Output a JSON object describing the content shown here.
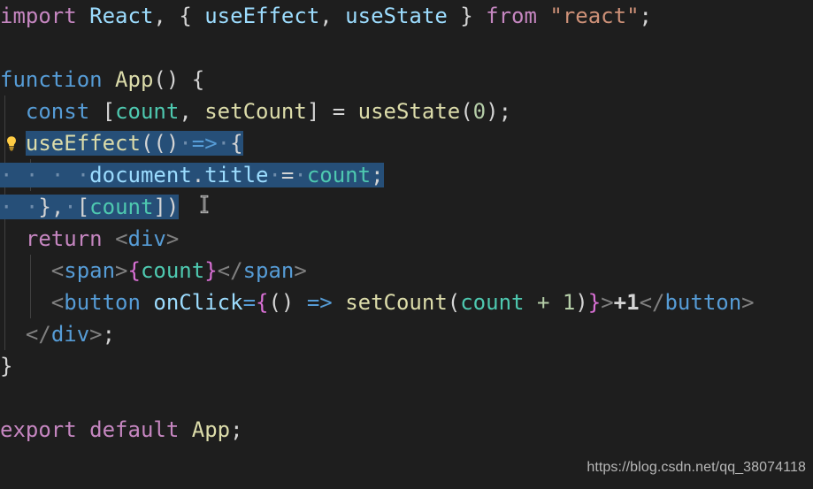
{
  "editor": {
    "theme_background": "#1e1e1e",
    "default_text_color": "#d4d4d4",
    "selection_color": "#264f78",
    "language": "javascript-react"
  },
  "code": {
    "line1": "import React, { useEffect, useState } from \"react\";",
    "line2": "",
    "line3": "function App() {",
    "line4": "  const [count, setCount] = useState(0);",
    "line5": "  useEffect(() => {",
    "line6": "    document.title = count;",
    "line7": "  }, [count])",
    "line8": "  return <div>",
    "line9": "    <span>{count}</span>",
    "line10": "    <button onClick={() => setCount(count + 1)}>+1</button>",
    "line11": "  </div>;",
    "line12": "}",
    "line13": "",
    "line14": "export default App;"
  },
  "tokens": {
    "import": "import",
    "react_ident": "React",
    "comma": ",",
    "brace_open": " { ",
    "useEffect": "useEffect",
    "useState": "useState",
    "brace_close": " } ",
    "from": "from",
    "react_string": "\"react\"",
    "semicolon": ";",
    "function": "function",
    "app": "App",
    "parens_empty": "() {",
    "const": "const",
    "count": "count",
    "setCount": "setCount",
    "equals": "=",
    "zero": "0",
    "one": "1",
    "arrow": "=>",
    "document": "document",
    "dot": ".",
    "title": "title",
    "return": "return",
    "div": "div",
    "span": "span",
    "button": "button",
    "onClick": "onClick",
    "plus": "+",
    "jsx_text": "+1",
    "export": "export",
    "default": "default",
    "lt": "<",
    "gt": ">",
    "close_tag": "</",
    "whitespace_dot": "·"
  },
  "selection": {
    "active": true,
    "lines": [
      "useEffect(() => {",
      "    document.title = count;",
      "  }, [count])"
    ]
  },
  "gutter": {
    "lightbulb_icon": "lightbulb-icon",
    "lightbulb_color": "#ffcc44"
  },
  "cursor": {
    "mouse_icon": "text-ibeam-cursor"
  },
  "watermark": {
    "text": "https://blog.csdn.net/qq_38074118"
  }
}
